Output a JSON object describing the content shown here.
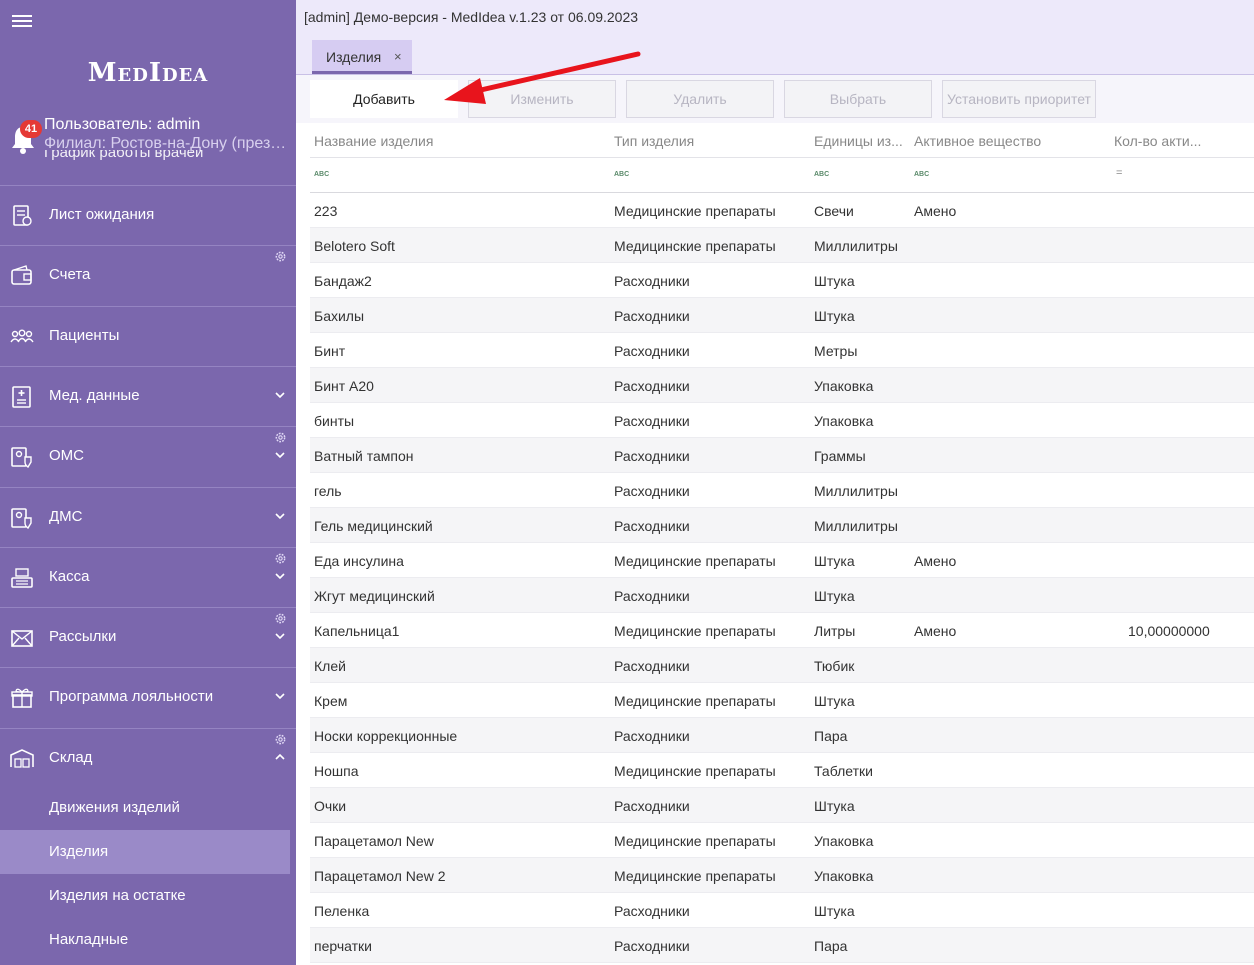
{
  "app": {
    "title": "[admin] Демо-версия  - MedIdea v.1.23 от 06.09.2023",
    "logo": "MedIdea"
  },
  "user": {
    "notifications": "41",
    "user_line": "Пользователь: admin",
    "branch_line": "Филиал: Ростов-на-Дону (презе...",
    "cut_item": "График работы врачей"
  },
  "sidebar": {
    "items": [
      {
        "label": "Лист ожидания",
        "icon": "clipboard-list-icon",
        "gear": false,
        "chevron": ""
      },
      {
        "label": "Счета",
        "icon": "wallet-icon",
        "gear": true,
        "chevron": ""
      },
      {
        "label": "Пациенты",
        "icon": "people-group-icon",
        "gear": false,
        "chevron": ""
      },
      {
        "label": "Мед. данные",
        "icon": "medical-record-icon",
        "gear": false,
        "chevron": "down"
      },
      {
        "label": "ОМС",
        "icon": "insurance-shield-icon",
        "gear": true,
        "chevron": "down"
      },
      {
        "label": "ДМС",
        "icon": "insurance-shield-icon",
        "gear": false,
        "chevron": "down"
      },
      {
        "label": "Касса",
        "icon": "cash-register-icon",
        "gear": true,
        "chevron": "down"
      },
      {
        "label": "Рассылки",
        "icon": "envelope-icon",
        "gear": true,
        "chevron": "down"
      },
      {
        "label": "Программа лояльности",
        "icon": "gift-icon",
        "gear": false,
        "chevron": "down"
      },
      {
        "label": "Склад",
        "icon": "warehouse-icon",
        "gear": true,
        "chevron": "up"
      }
    ],
    "subitems": [
      {
        "label": "Движения изделий",
        "active": false
      },
      {
        "label": "Изделия",
        "active": true
      },
      {
        "label": "Изделия на остатке",
        "active": false
      },
      {
        "label": "Накладные",
        "active": false
      }
    ]
  },
  "tab": {
    "label": "Изделия",
    "close": "×"
  },
  "toolbar": {
    "add": "Добавить",
    "edit": "Изменить",
    "delete": "Удалить",
    "select": "Выбрать",
    "priority": "Установить приоритет"
  },
  "grid": {
    "columns": [
      "Название изделия",
      "Тип изделия",
      "Единицы из...",
      "Активное вещество",
      "Кол-во акти..."
    ],
    "filter_icons": [
      "ABC",
      "ABC",
      "ABC",
      "ABC",
      "="
    ],
    "rows": [
      [
        "223",
        "Медицинские препараты",
        "Свечи",
        "Амено",
        ""
      ],
      [
        "Belotero Soft",
        "Медицинские препараты",
        "Миллилитры",
        "",
        ""
      ],
      [
        "Бандаж2",
        "Расходники",
        "Штука",
        "",
        ""
      ],
      [
        "Бахилы",
        "Расходники",
        "Штука",
        "",
        ""
      ],
      [
        "Бинт",
        "Расходники",
        "Метры",
        "",
        ""
      ],
      [
        "Бинт А20",
        "Расходники",
        "Упаковка",
        "",
        ""
      ],
      [
        "бинты",
        "Расходники",
        "Упаковка",
        "",
        ""
      ],
      [
        "Ватный тампон",
        "Расходники",
        "Граммы",
        "",
        ""
      ],
      [
        "гель",
        "Расходники",
        "Миллилитры",
        "",
        ""
      ],
      [
        "Гель медицинский",
        "Расходники",
        "Миллилитры",
        "",
        ""
      ],
      [
        "Еда инсулина",
        "Медицинские препараты",
        "Штука",
        "Амено",
        ""
      ],
      [
        "Жгут медицинский",
        "Расходники",
        "Штука",
        "",
        ""
      ],
      [
        "Капельница1",
        "Медицинские препараты",
        "Литры",
        "Амено",
        "10,00000000"
      ],
      [
        "Клей",
        "Расходники",
        "Тюбик",
        "",
        ""
      ],
      [
        "Крем",
        "Медицинские препараты",
        "Штука",
        "",
        ""
      ],
      [
        "Носки коррекционные",
        "Расходники",
        "Пара",
        "",
        ""
      ],
      [
        "Ношпа",
        "Медицинские препараты",
        "Таблетки",
        "",
        ""
      ],
      [
        "Очки",
        "Расходники",
        "Штука",
        "",
        ""
      ],
      [
        "Парацетамол New",
        "Медицинские препараты",
        "Упаковка",
        "",
        ""
      ],
      [
        "Парацетамол New 2",
        "Медицинские препараты",
        "Упаковка",
        "",
        ""
      ],
      [
        "Пеленка",
        "Расходники",
        "Штука",
        "",
        ""
      ],
      [
        "перчатки",
        "Расходники",
        "Пара",
        "",
        ""
      ]
    ]
  },
  "colors": {
    "sidebar": "#7b67ad",
    "active_subitem": "#9a8ac8",
    "header_bg": "#ede9fa",
    "badge": "#e53935",
    "arrow": "#e8141c"
  }
}
